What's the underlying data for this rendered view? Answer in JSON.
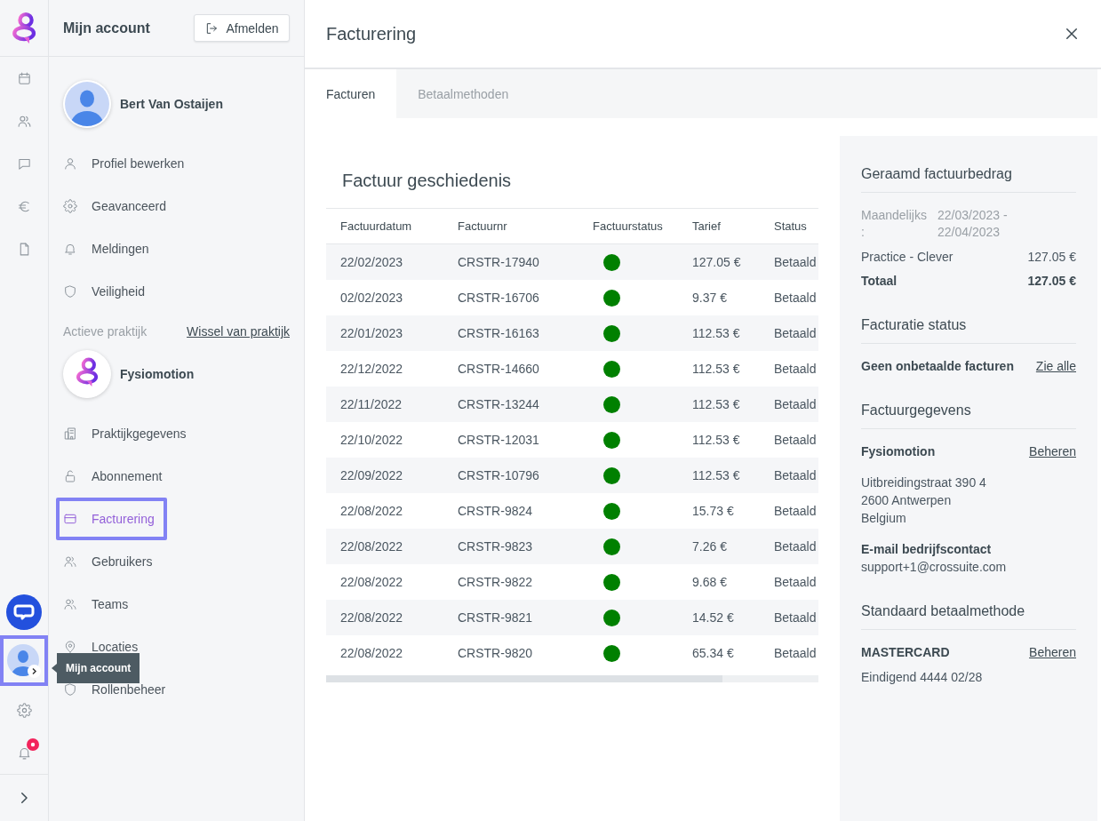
{
  "rail": {
    "account": {
      "highlighted": true,
      "tooltip": "Mijn account"
    },
    "notifications": {
      "unread": true
    }
  },
  "sidebar": {
    "title": "Mijn account",
    "logout_button": "Afmelden",
    "user": {
      "name": "Bert Van Ostaijen"
    },
    "account_menu": [
      {
        "label": "Profiel bewerken",
        "selected": false,
        "highlighted": false
      },
      {
        "label": "Geavanceerd",
        "selected": false,
        "highlighted": false
      },
      {
        "label": "Meldingen",
        "selected": false,
        "highlighted": false
      },
      {
        "label": "Veiligheid",
        "selected": false,
        "highlighted": false
      }
    ],
    "practice": {
      "label": "Actieve praktijk",
      "switch_link": "Wissel van praktijk",
      "name": "Fysiomotion"
    },
    "practice_menu": [
      {
        "label": "Praktijkgegevens",
        "selected": false,
        "highlighted": false
      },
      {
        "label": "Abonnement",
        "selected": false,
        "highlighted": false
      },
      {
        "label": "Facturering",
        "selected": true,
        "highlighted": true
      },
      {
        "label": "Gebruikers",
        "selected": false,
        "highlighted": false
      },
      {
        "label": "Teams",
        "selected": false,
        "highlighted": false
      },
      {
        "label": "Locaties",
        "selected": false,
        "highlighted": false
      },
      {
        "label": "Rollenbeheer",
        "selected": false,
        "highlighted": false
      }
    ]
  },
  "main": {
    "title": "Facturering",
    "tabs": [
      {
        "label": "Facturen",
        "selected": true
      },
      {
        "label": "Betaalmethoden",
        "selected": false
      }
    ],
    "invoice_history": {
      "title": "Factuur geschiedenis",
      "columns": [
        "Factuurdatum",
        "Factuurnr",
        "Factuurstatus",
        "Tarief",
        "Status"
      ],
      "rows": [
        {
          "date": "22/02/2023",
          "number": "CRSTR-17940",
          "color": "#008000",
          "amount": "127.05 €",
          "status": "Betaald"
        },
        {
          "date": "02/02/2023",
          "number": "CRSTR-16706",
          "color": "#008000",
          "amount": "9.37 €",
          "status": "Betaald"
        },
        {
          "date": "22/01/2023",
          "number": "CRSTR-16163",
          "color": "#008000",
          "amount": "112.53 €",
          "status": "Betaald"
        },
        {
          "date": "22/12/2022",
          "number": "CRSTR-14660",
          "color": "#008000",
          "amount": "112.53 €",
          "status": "Betaald"
        },
        {
          "date": "22/11/2022",
          "number": "CRSTR-13244",
          "color": "#008000",
          "amount": "112.53 €",
          "status": "Betaald"
        },
        {
          "date": "22/10/2022",
          "number": "CRSTR-12031",
          "color": "#008000",
          "amount": "112.53 €",
          "status": "Betaald"
        },
        {
          "date": "22/09/2022",
          "number": "CRSTR-10796",
          "color": "#008000",
          "amount": "112.53 €",
          "status": "Betaald"
        },
        {
          "date": "22/08/2022",
          "number": "CRSTR-9824",
          "color": "#008000",
          "amount": "15.73 €",
          "status": "Betaald"
        },
        {
          "date": "22/08/2022",
          "number": "CRSTR-9823",
          "color": "#008000",
          "amount": "7.26 €",
          "status": "Betaald"
        },
        {
          "date": "22/08/2022",
          "number": "CRSTR-9822",
          "color": "#008000",
          "amount": "9.68 €",
          "status": "Betaald"
        },
        {
          "date": "22/08/2022",
          "number": "CRSTR-9821",
          "color": "#008000",
          "amount": "14.52 €",
          "status": "Betaald"
        },
        {
          "date": "22/08/2022",
          "number": "CRSTR-9820",
          "color": "#008000",
          "amount": "65.34 €",
          "status": "Betaald"
        }
      ]
    },
    "summary": {
      "estimate": {
        "title": "Geraamd factuurbedrag",
        "period_label": "Maandelijks :",
        "period": "22/03/2023 - 22/04/2023",
        "lines": [
          {
            "label": "Practice - Clever",
            "amount": "127.05 €"
          }
        ],
        "total_label": "Totaal",
        "total": "127.05 €"
      },
      "billing_status": {
        "title": "Facturatie status",
        "text": "Geen onbetaalde facturen",
        "link": "Zie alle"
      },
      "billing_details": {
        "title": "Factuurgegevens",
        "company": "Fysiomotion",
        "link": "Beheren",
        "address": [
          "Uitbreidingstraat 390 4",
          "2600 Antwerpen",
          "Belgium"
        ],
        "email_label": "E-mail bedrijfscontact",
        "email": "support+1@crossuite.com"
      },
      "payment_method": {
        "title": "Standaard betaalmethode",
        "brand": "MASTERCARD",
        "link": "Beheren",
        "detail": "Eindigend 4444 02/28"
      }
    }
  }
}
